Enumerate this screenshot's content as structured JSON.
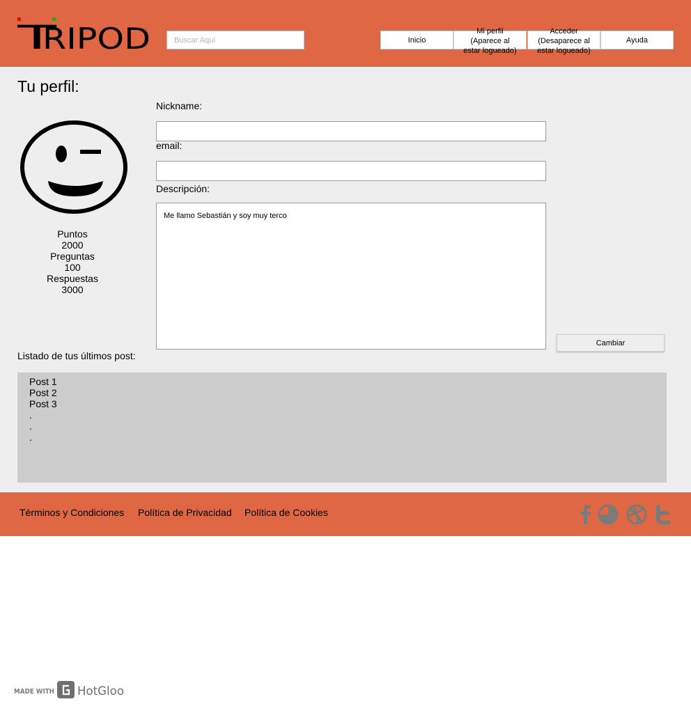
{
  "header": {
    "logo_text": "TRIPOD",
    "search": {
      "placeholder": "Buscar Aquí",
      "value": ""
    },
    "nav": [
      {
        "label": "Inicio"
      },
      {
        "label": "Mi perfil\n(Aparece al\nestar logueado)"
      },
      {
        "label": "Acceder\n(Desaparece al\nestar logueado)"
      },
      {
        "label": "Ayuda"
      }
    ]
  },
  "profile": {
    "title": "Tu perfil:",
    "avatar_icon": "wink-smiley-icon",
    "stats": [
      {
        "label": "Puntos",
        "value": "2000"
      },
      {
        "label": "Preguntas",
        "value": "100"
      },
      {
        "label": "Respuestas",
        "value": "3000"
      }
    ]
  },
  "form": {
    "nickname_label": "Nickname:",
    "nickname_value": "",
    "email_label": "email:",
    "email_value": "",
    "description_label": "Descripción:",
    "description_value": "Me llamo Sebastián y soy muy terco",
    "submit_label": "Cambiar"
  },
  "posts": {
    "label": "Listado de tus últimos post:",
    "items": [
      "Post 1",
      "Post 2",
      "Post 3",
      ".",
      ".",
      "."
    ]
  },
  "footer": {
    "links": [
      "Términos y Condiciones",
      "Política de Privacidad",
      "Política de Cookies"
    ],
    "social_icons": [
      "facebook-icon",
      "picasa-icon",
      "dribbble-icon",
      "twitter-icon"
    ]
  },
  "badge": {
    "made_with": "MADE WITH",
    "brand": "HotGloo"
  },
  "colors": {
    "brand": "#df6744",
    "background": "#eeeeee",
    "posts_box": "#cccccc",
    "icon_gray": "#7a7a7a"
  }
}
